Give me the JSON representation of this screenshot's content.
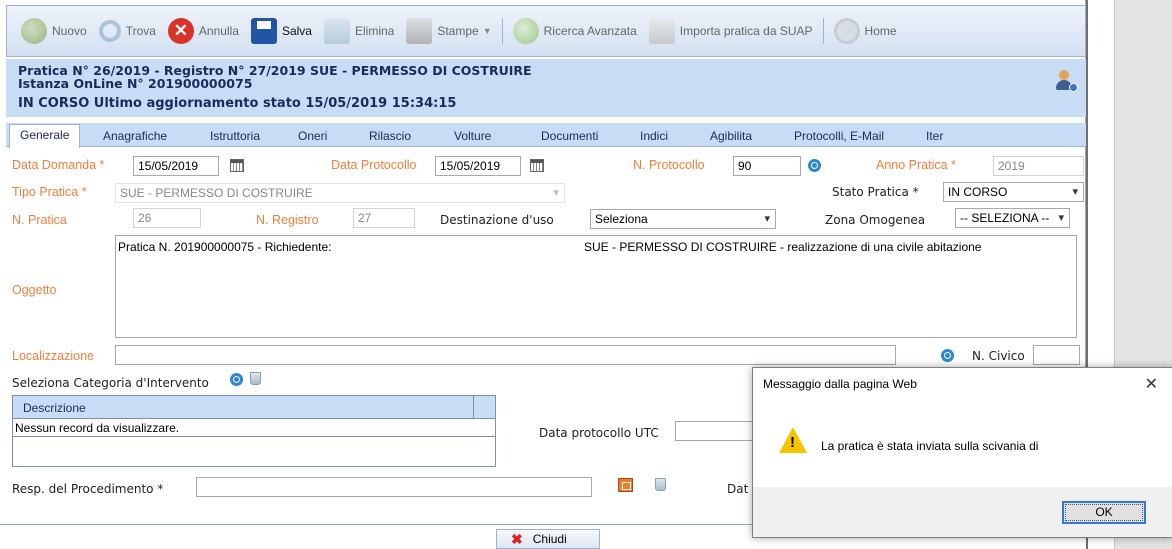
{
  "toolbar": {
    "items": [
      {
        "label": "Nuovo",
        "icon": "add-icon"
      },
      {
        "label": "Trova",
        "icon": "search-icon"
      },
      {
        "label": "Annulla",
        "icon": "cancel-icon"
      },
      {
        "label": "Salva",
        "icon": "save-icon"
      },
      {
        "label": "Elimina",
        "icon": "trash-icon"
      },
      {
        "label": "Stampe",
        "icon": "print-icon"
      },
      {
        "label": "Ricerca Avanzata",
        "icon": "advanced-search-icon"
      },
      {
        "label": "Importa pratica da SUAP",
        "icon": "import-icon"
      },
      {
        "label": "Home",
        "icon": "home-icon"
      }
    ]
  },
  "header": {
    "line1": "Pratica N° 26/2019 - Registro N° 27/2019 SUE - PERMESSO DI COSTRUIRE",
    "line2": "Istanza OnLine N° 201900000075",
    "line3": "IN CORSO Ultimo aggiornamento stato 15/05/2019 15:34:15"
  },
  "tabs": [
    "Generale",
    "Anagrafiche",
    "Istruttoria",
    "Oneri",
    "Rilascio",
    "Volture",
    "Documenti",
    "Indici",
    "Agibilita",
    "Protocolli, E-Mail",
    "Iter"
  ],
  "form": {
    "data_domanda_label": "Data Domanda *",
    "data_domanda": "15/05/2019",
    "data_protocollo_label": "Data Protocollo",
    "data_protocollo": "15/05/2019",
    "n_protocollo_label": "N. Protocollo",
    "n_protocollo": "90",
    "anno_pratica_label": "Anno Pratica *",
    "anno_pratica": "2019",
    "tipo_pratica_label": "Tipo Pratica *",
    "tipo_pratica": "SUE - PERMESSO DI COSTRUIRE",
    "stato_pratica_label": "Stato Pratica *",
    "stato_pratica": "IN CORSO",
    "n_pratica_label": "N. Pratica",
    "n_pratica": "26",
    "n_registro_label": "N. Registro",
    "n_registro": "27",
    "destinazione_label": "Destinazione d'uso",
    "destinazione": "Seleziona",
    "zona_label": "Zona Omogenea",
    "zona": "-- SELEZIONA --",
    "oggetto_label": "Oggetto",
    "oggetto_left": "Pratica N. 201900000075 - Richiedente:",
    "oggetto_right": "SUE - PERMESSO DI COSTRUIRE - realizzazione di una civile abitazione",
    "localizzazione_label": "Localizzazione",
    "localizzazione": "",
    "n_civico_label": "N. Civico",
    "n_civico": "",
    "categoria_label": "Seleziona Categoria d'Intervento",
    "grid_header": "Descrizione",
    "grid_empty": "Nessun record da visualizzare.",
    "data_utc_label": "Data protocollo UTC",
    "data_utc": "",
    "resp_label": "Resp. del Procedimento *",
    "data_label_partial": "Dat"
  },
  "footer": {
    "close_label": "Chiudi"
  },
  "dialog": {
    "title": "Messaggio dalla pagina Web",
    "message": "La pratica è stata inviata sulla scivania di",
    "ok_label": "OK"
  }
}
